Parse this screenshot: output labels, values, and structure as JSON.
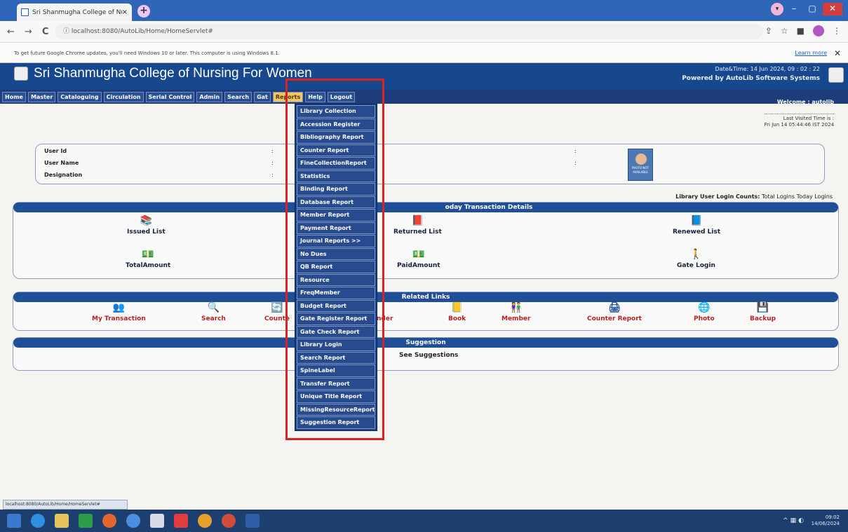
{
  "browser": {
    "tab_title": "Sri Shanmugha College of Nursi",
    "tab_close": "×",
    "new_tab": "+",
    "window_controls": [
      "–",
      "▢",
      "✕"
    ],
    "back": "←",
    "forward": "→",
    "reload": "C",
    "url": "localhost:8080/AutoLib/Home/HomeServlet#",
    "info_message": "To get future Google Chrome updates, you'll need Windows 10 or later. This computer is using Windows 8.1.",
    "learn_more": "Learn more",
    "info_close": "✕"
  },
  "header": {
    "college": "Sri Shanmugha College of Nursing For Women",
    "datetime": "Date&Time:  14 Jun 2024, 09 : 02 : 22",
    "powered": "Powered by AutoLib Software Systems",
    "welcome": "Welcome  :  autolib"
  },
  "nav": {
    "items": [
      "Home",
      "Master",
      "Cataloguing",
      "Circulation",
      "Serial Control",
      "Admin",
      "Search",
      "Gat",
      "Reports",
      "Help",
      "Logout"
    ]
  },
  "reports_menu": {
    "items": [
      "Library Collection",
      "Accession Register",
      "Bibliography Report",
      "Counter Report",
      "FineCollectionReport",
      "Statistics",
      "Binding Report",
      "Database Report",
      "Member Report",
      "Payment Report",
      "Journal Reports  >>",
      "No Dues",
      "QB Report",
      "Resource",
      "FreqMember",
      "Budget Report",
      "Gate Register Report",
      "Gate Check Report",
      "Library Login",
      "Search Report",
      "SpineLabel",
      "Transfer Report",
      "Unique Title Report",
      "MissingResourceReport",
      "Suggestion Report"
    ]
  },
  "last_visited": {
    "label": "Last Visited Time is :",
    "value": "Fri Jun 14 05:44:46 IST 2024"
  },
  "user_panel": {
    "fields": [
      "User Id",
      "User Name",
      "Designation"
    ],
    "colon": ":",
    "photo_text": "PHOTO NOT AVAILABLE"
  },
  "logins": {
    "label": "Library User Login Counts:",
    "total": "Total Logins",
    "today": "Today Logins"
  },
  "transactions": {
    "title": "oday Transaction Details",
    "items": [
      "Issued List",
      "Returned List",
      "Renewed List",
      "TotalAmount",
      "PaidAmount",
      "Gate Login"
    ]
  },
  "related": {
    "title": "Related Links",
    "items": [
      "My Transaction",
      "Search",
      "Counte",
      "nder",
      "Book",
      "Member",
      "Counter Report",
      "Photo",
      "Backup"
    ]
  },
  "suggestion": {
    "title": "Suggestion",
    "link": "See Suggestions"
  },
  "status_url": "localhost:8080/AutoLib/Home/HomeServlet#",
  "tray": {
    "time": "09:02",
    "date": "14/06/2024"
  },
  "colors": {
    "header": "#17488e",
    "menu": "#274b8e",
    "highlight": "#d82424",
    "link_red": "#b91f1f"
  }
}
